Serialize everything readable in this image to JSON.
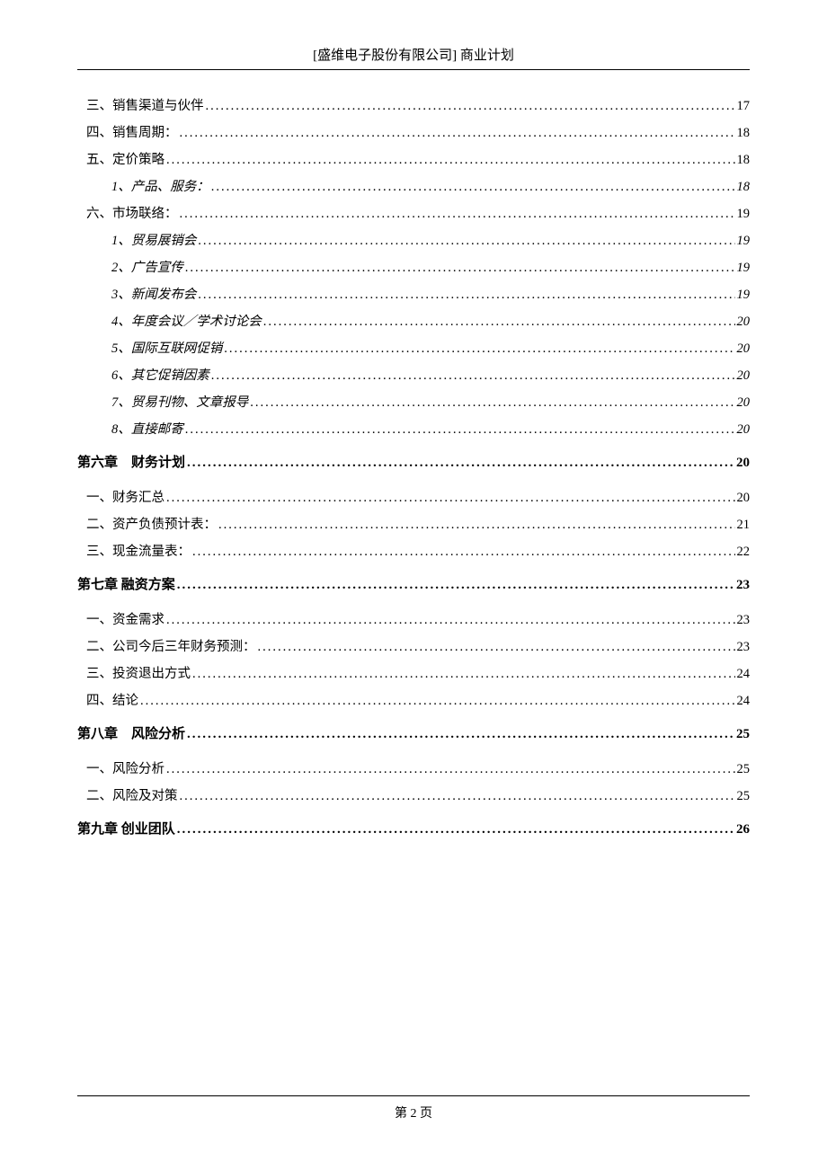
{
  "header": "[盛维电子股份有限公司] 商业计划",
  "footer_prefix": "第 ",
  "footer_page": "2",
  "footer_suffix": " 页",
  "toc": [
    {
      "level": 2,
      "label": "三、销售渠道与伙伴",
      "page": "17"
    },
    {
      "level": 2,
      "label": "四、销售周期：",
      "page": "18"
    },
    {
      "level": 2,
      "label": "五、定价策略",
      "page": "18"
    },
    {
      "level": 3,
      "label": "1、产品、服务：",
      "page": "18"
    },
    {
      "level": 2,
      "label": "六、市场联络：",
      "page": "19"
    },
    {
      "level": 3,
      "label": "1、贸易展销会",
      "page": "19"
    },
    {
      "level": 3,
      "label": "2、广告宣传",
      "page": "19"
    },
    {
      "level": 3,
      "label": "3、新闻发布会",
      "page": "19"
    },
    {
      "level": 3,
      "label": "4、年度会议／学术讨论会",
      "page": "20"
    },
    {
      "level": 3,
      "label": "5、国际互联网促销",
      "page": "20"
    },
    {
      "level": 3,
      "label": "6、其它促销因素",
      "page": "20"
    },
    {
      "level": 3,
      "label": "7、贸易刊物、文章报导",
      "page": "20"
    },
    {
      "level": 3,
      "label": "8、直接邮寄",
      "page": "20"
    },
    {
      "level": 1,
      "label": "第六章 财务计划",
      "page": "20",
      "chapter": true
    },
    {
      "level": 2,
      "label": "一、财务汇总",
      "page": "20",
      "gap": true
    },
    {
      "level": 2,
      "label": "二、资产负债预计表：",
      "page": "21"
    },
    {
      "level": 2,
      "label": "三、现金流量表：",
      "page": "22"
    },
    {
      "level": 1,
      "label": "第七章 融资方案",
      "page": "23",
      "chapter": true
    },
    {
      "level": 2,
      "label": "一、资金需求",
      "page": "23",
      "gap": true
    },
    {
      "level": 2,
      "label": "二、公司今后三年财务预测：",
      "page": "23"
    },
    {
      "level": 2,
      "label": "三、投资退出方式",
      "page": "24"
    },
    {
      "level": 2,
      "label": "四、结论",
      "page": "24"
    },
    {
      "level": 1,
      "label": "第八章 风险分析",
      "page": "25",
      "chapter": true
    },
    {
      "level": 2,
      "label": "一、风险分析",
      "page": "25",
      "gap": true
    },
    {
      "level": 2,
      "label": "二、风险及对策",
      "page": "25"
    },
    {
      "level": 1,
      "label": "第九章 创业团队",
      "page": "26",
      "chapter": true
    }
  ]
}
